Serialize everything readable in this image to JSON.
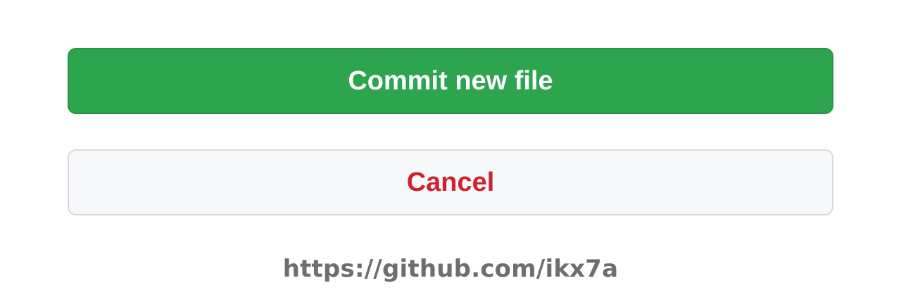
{
  "actions": {
    "commit_label": "Commit new file",
    "cancel_label": "Cancel"
  },
  "watermark": {
    "url": "https://github.com/ikx7a"
  },
  "colors": {
    "primary_green": "#2da44e",
    "danger_red": "#cf222e",
    "neutral_bg": "#f6f8fa",
    "watermark_gray": "#6e6e6e"
  }
}
